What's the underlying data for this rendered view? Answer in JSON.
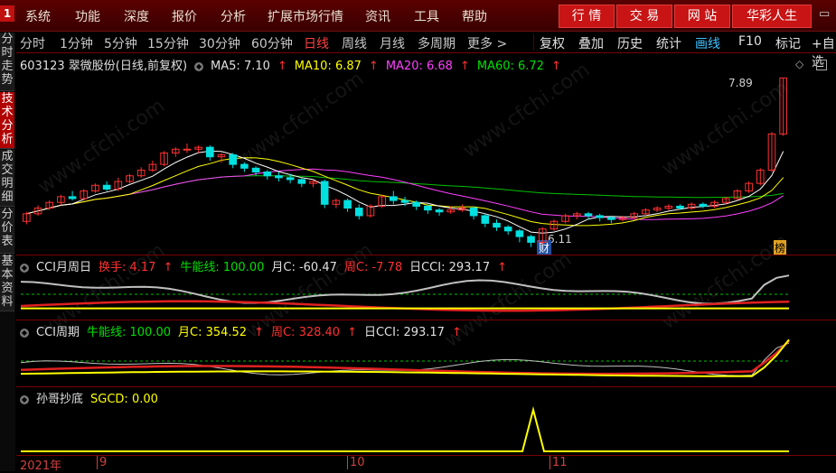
{
  "menubar": {
    "logo": "1",
    "items": [
      "系统",
      "功能",
      "深度",
      "报价",
      "分析",
      "扩展市场行情",
      "资讯",
      "工具",
      "帮助"
    ],
    "buttons": [
      "行 情",
      "交 易",
      "网 站",
      "华彩人生"
    ]
  },
  "sidetabs": [
    "分时走势",
    "技术分析",
    "成交明细",
    "分价表",
    "基本资料"
  ],
  "toolbar": {
    "periods": [
      "分时",
      "1分钟",
      "5分钟",
      "15分钟",
      "30分钟",
      "60分钟",
      "日线",
      "周线",
      "月线",
      "多周期",
      "更多 >"
    ],
    "tools": [
      "复权",
      "叠加",
      "历史",
      "统计",
      "画线",
      "F10",
      "标记",
      "+自选"
    ]
  },
  "main_info": {
    "stock": "603123 翠微股份(日线,前复权)",
    "ma5": "MA5: 7.10",
    "ma10": "MA10: 6.87",
    "ma20": "MA20: 6.68",
    "ma60": "MA60: 6.72",
    "high_label": "7.89",
    "low_label": "6.11",
    "cai": "财",
    "bang": "榜"
  },
  "cci1_info": {
    "name": "CCI月周日",
    "huanshou": "换手: 4.17",
    "niuneng": "牛能线: 100.00",
    "yuec": "月C: -60.47",
    "zhouc": "周C: -7.78",
    "ric": "日CCI: 293.17"
  },
  "cci2_info": {
    "name": "CCI周期",
    "niuneng": "牛能线: 100.00",
    "yuec": "月C: 354.52",
    "zhouc": "周C: 328.40",
    "ric": "日CCI: 293.17"
  },
  "sgcd_info": {
    "name": "孙哥抄底",
    "value": "SGCD: 0.00"
  },
  "xaxis": {
    "year": "2021年",
    "labels": [
      "9",
      "10",
      "11"
    ]
  },
  "watermark": "www.cfchi.com",
  "colors": {
    "up": "#ff3030",
    "down": "#00e0e0",
    "ma5": "#ffffff",
    "ma10": "#ffff00",
    "ma20": "#ff40ff",
    "ma60": "#00c000"
  },
  "chart_data": {
    "type": "candlestick",
    "candles": [
      [
        6.38,
        6.46,
        6.35,
        6.48
      ],
      [
        6.46,
        6.52,
        6.44,
        6.55
      ],
      [
        6.52,
        6.58,
        6.5,
        6.6
      ],
      [
        6.58,
        6.64,
        6.55,
        6.66
      ],
      [
        6.64,
        6.62,
        6.6,
        6.7
      ],
      [
        6.62,
        6.7,
        6.6,
        6.72
      ],
      [
        6.7,
        6.76,
        6.68,
        6.78
      ],
      [
        6.76,
        6.72,
        6.7,
        6.8
      ],
      [
        6.72,
        6.8,
        6.7,
        6.84
      ],
      [
        6.8,
        6.86,
        6.78,
        6.88
      ],
      [
        6.86,
        6.92,
        6.84,
        6.95
      ],
      [
        6.92,
        6.98,
        6.9,
        7.02
      ],
      [
        6.98,
        7.1,
        6.96,
        7.12
      ],
      [
        7.1,
        7.14,
        7.06,
        7.16
      ],
      [
        7.14,
        7.14,
        7.1,
        7.2
      ],
      [
        7.14,
        7.16,
        7.1,
        7.18
      ],
      [
        7.16,
        7.06,
        7.02,
        7.18
      ],
      [
        7.06,
        7.08,
        7.0,
        7.1
      ],
      [
        7.08,
        6.98,
        6.94,
        7.1
      ],
      [
        6.98,
        6.94,
        6.9,
        7.0
      ],
      [
        6.94,
        6.9,
        6.86,
        6.96
      ],
      [
        6.9,
        6.86,
        6.82,
        6.92
      ],
      [
        6.86,
        6.84,
        6.8,
        6.9
      ],
      [
        6.84,
        6.82,
        6.78,
        6.88
      ],
      [
        6.82,
        6.78,
        6.74,
        6.84
      ],
      [
        6.78,
        6.8,
        6.74,
        6.82
      ],
      [
        6.8,
        6.56,
        6.52,
        6.82
      ],
      [
        6.56,
        6.6,
        6.52,
        6.62
      ],
      [
        6.6,
        6.52,
        6.48,
        6.62
      ],
      [
        6.52,
        6.44,
        6.4,
        6.56
      ],
      [
        6.44,
        6.54,
        6.42,
        6.56
      ],
      [
        6.54,
        6.64,
        6.52,
        6.66
      ],
      [
        6.64,
        6.6,
        6.56,
        6.7
      ],
      [
        6.6,
        6.58,
        6.54,
        6.64
      ],
      [
        6.58,
        6.54,
        6.5,
        6.6
      ],
      [
        6.54,
        6.5,
        6.46,
        6.56
      ],
      [
        6.5,
        6.48,
        6.44,
        6.52
      ],
      [
        6.48,
        6.5,
        6.46,
        6.54
      ],
      [
        6.5,
        6.52,
        6.48,
        6.56
      ],
      [
        6.52,
        6.44,
        6.4,
        6.54
      ],
      [
        6.44,
        6.36,
        6.32,
        6.46
      ],
      [
        6.36,
        6.32,
        6.28,
        6.4
      ],
      [
        6.32,
        6.28,
        6.24,
        6.34
      ],
      [
        6.28,
        6.22,
        6.16,
        6.3
      ],
      [
        6.22,
        6.16,
        6.11,
        6.24
      ],
      [
        6.16,
        6.3,
        6.14,
        6.32
      ],
      [
        6.3,
        6.38,
        6.28,
        6.4
      ],
      [
        6.38,
        6.44,
        6.36,
        6.46
      ],
      [
        6.44,
        6.46,
        6.4,
        6.48
      ],
      [
        6.46,
        6.44,
        6.4,
        6.48
      ],
      [
        6.44,
        6.42,
        6.38,
        6.46
      ],
      [
        6.42,
        6.4,
        6.36,
        6.44
      ],
      [
        6.4,
        6.42,
        6.38,
        6.44
      ],
      [
        6.42,
        6.46,
        6.4,
        6.48
      ],
      [
        6.46,
        6.5,
        6.44,
        6.52
      ],
      [
        6.5,
        6.52,
        6.48,
        6.54
      ],
      [
        6.52,
        6.54,
        6.5,
        6.56
      ],
      [
        6.54,
        6.52,
        6.5,
        6.56
      ],
      [
        6.52,
        6.56,
        6.5,
        6.58
      ],
      [
        6.56,
        6.54,
        6.52,
        6.58
      ],
      [
        6.54,
        6.58,
        6.52,
        6.6
      ],
      [
        6.58,
        6.62,
        6.56,
        6.64
      ],
      [
        6.62,
        6.7,
        6.6,
        6.72
      ],
      [
        6.7,
        6.78,
        6.68,
        6.8
      ],
      [
        6.78,
        6.92,
        6.76,
        6.94
      ],
      [
        6.92,
        7.3,
        6.9,
        7.32
      ],
      [
        7.3,
        7.89,
        7.28,
        7.89
      ]
    ],
    "ylim": [
      6.05,
      7.95
    ]
  }
}
